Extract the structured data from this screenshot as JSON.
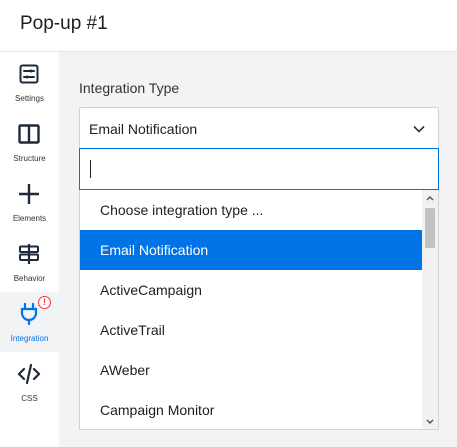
{
  "header": {
    "title": "Pop-up #1"
  },
  "sidebar": {
    "items": [
      {
        "label": "Settings",
        "icon": "settings-icon"
      },
      {
        "label": "Structure",
        "icon": "structure-icon"
      },
      {
        "label": "Elements",
        "icon": "plus-icon"
      },
      {
        "label": "Behavior",
        "icon": "signpost-icon"
      },
      {
        "label": "Integration",
        "icon": "plug-icon",
        "active": true,
        "badge": "!"
      },
      {
        "label": "CSS",
        "icon": "code-icon"
      }
    ]
  },
  "integration": {
    "field_label": "Integration Type",
    "selected_value": "Email Notification",
    "search_value": "",
    "options": [
      {
        "label": "Choose integration type ..."
      },
      {
        "label": "Email Notification",
        "selected": true
      },
      {
        "label": "ActiveCampaign"
      },
      {
        "label": "ActiveTrail"
      },
      {
        "label": "AWeber"
      },
      {
        "label": "Campaign Monitor"
      }
    ]
  },
  "colors": {
    "accent": "#0073e6",
    "badge": "#e03a3a",
    "panel_bg": "#f2f3f4"
  }
}
